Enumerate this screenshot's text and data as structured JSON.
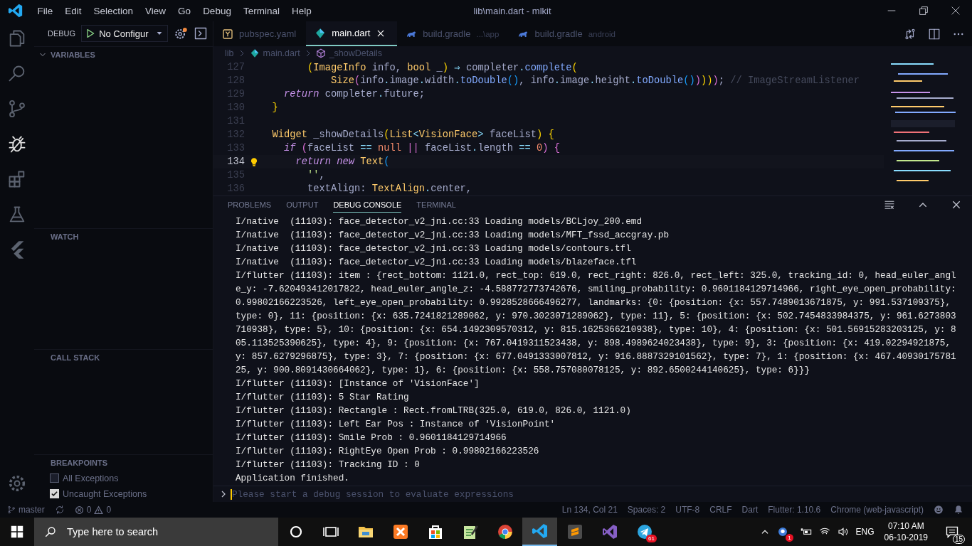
{
  "window": {
    "title": "lib\\main.dart - mlkit",
    "menu": [
      "File",
      "Edit",
      "Selection",
      "View",
      "Go",
      "Debug",
      "Terminal",
      "Help"
    ]
  },
  "activity_bar": {
    "items": [
      {
        "kind": "files",
        "selected": false
      },
      {
        "kind": "search",
        "selected": false
      },
      {
        "kind": "scm",
        "selected": false
      },
      {
        "kind": "debug",
        "selected": true
      },
      {
        "kind": "extensions",
        "selected": false
      },
      {
        "kind": "flask",
        "selected": false
      },
      {
        "kind": "flutter",
        "selected": false
      }
    ]
  },
  "sidebar": {
    "title": "DEBUG",
    "configuration": "No Configur",
    "sections": [
      {
        "title": "VARIABLES",
        "focused": true
      },
      {
        "title": "WATCH",
        "focused": false
      },
      {
        "title": "CALL STACK",
        "focused": false
      },
      {
        "title": "BREAKPOINTS",
        "focused": false,
        "items": [
          {
            "label": "All Exceptions",
            "checked": false
          },
          {
            "label": "Uncaught Exceptions",
            "checked": true
          }
        ]
      }
    ]
  },
  "tabs": [
    {
      "kind": "yaml",
      "label": "pubspec.yaml",
      "selected": false
    },
    {
      "kind": "dart",
      "label": "main.dart",
      "selected": true
    },
    {
      "kind": "gradle",
      "label": "build.gradle",
      "hint": "...\\app",
      "selected": false
    },
    {
      "kind": "gradle",
      "label": "build.gradle",
      "hint": "android",
      "selected": false
    }
  ],
  "breadcrumbs": [
    "lib",
    "main.dart",
    "_showDetails"
  ],
  "code": [
    {
      "number": "127",
      "current": false,
      "tokens": [
        {
          "text": "        (",
          "kind": "b1"
        },
        {
          "text": "ImageInfo",
          "kind": "t"
        },
        {
          "text": " info, ",
          "kind": "p"
        },
        {
          "text": "bool",
          "kind": "t"
        },
        {
          "text": " _",
          "kind": "p"
        },
        {
          "text": ")",
          "kind": "b1"
        },
        {
          "text": " ⇒ ",
          "kind": "o"
        },
        {
          "text": "completer",
          "kind": "p"
        },
        {
          "text": ".",
          "kind": "o"
        },
        {
          "text": "complete",
          "kind": "f"
        },
        {
          "text": "(",
          "kind": "b1"
        }
      ]
    },
    {
      "number": "128",
      "current": false,
      "tokens": [
        {
          "text": "            Size",
          "kind": "t"
        },
        {
          "text": "(",
          "kind": "b2"
        },
        {
          "text": "info",
          "kind": "p"
        },
        {
          "text": ".",
          "kind": "o"
        },
        {
          "text": "image",
          "kind": "p"
        },
        {
          "text": ".",
          "kind": "o"
        },
        {
          "text": "width",
          "kind": "p"
        },
        {
          "text": ".",
          "kind": "o"
        },
        {
          "text": "toDouble",
          "kind": "f"
        },
        {
          "text": "()",
          "kind": "b3"
        },
        {
          "text": ", info",
          "kind": "p"
        },
        {
          "text": ".",
          "kind": "o"
        },
        {
          "text": "image",
          "kind": "p"
        },
        {
          "text": ".",
          "kind": "o"
        },
        {
          "text": "height",
          "kind": "p"
        },
        {
          "text": ".",
          "kind": "o"
        },
        {
          "text": "toDouble",
          "kind": "f"
        },
        {
          "text": "()",
          "kind": "b3"
        },
        {
          "text": ")",
          "kind": "b2"
        },
        {
          "text": "))",
          "kind": "b1"
        },
        {
          "text": ")",
          "kind": "b2"
        },
        {
          "text": ";",
          "kind": "p"
        },
        {
          "text": " // ImageStreamListener",
          "kind": "c"
        }
      ]
    },
    {
      "number": "129",
      "current": false,
      "tokens": [
        {
          "text": "    return",
          "kind": "k"
        },
        {
          "text": " completer",
          "kind": "p"
        },
        {
          "text": ".",
          "kind": "o"
        },
        {
          "text": "future;",
          "kind": "p"
        }
      ]
    },
    {
      "number": "130",
      "current": false,
      "tokens": [
        {
          "text": "  }",
          "kind": "b1"
        }
      ]
    },
    {
      "number": "131",
      "current": false
    },
    {
      "number": "132",
      "current": false,
      "tokens": [
        {
          "text": "  Widget",
          "kind": "t"
        },
        {
          "text": " _showDetails",
          "kind": "p"
        },
        {
          "text": "(",
          "kind": "b1"
        },
        {
          "text": "List",
          "kind": "t"
        },
        {
          "text": "<",
          "kind": "o"
        },
        {
          "text": "VisionFace",
          "kind": "t"
        },
        {
          "text": ">",
          "kind": "o"
        },
        {
          "text": " faceList",
          "kind": "p"
        },
        {
          "text": ") {",
          "kind": "b1"
        }
      ]
    },
    {
      "number": "133",
      "current": false,
      "tokens": [
        {
          "text": "    if",
          "kind": "k"
        },
        {
          "text": " (",
          "kind": "b2"
        },
        {
          "text": "faceList ",
          "kind": "p"
        },
        {
          "text": "==",
          "kind": "o"
        },
        {
          "text": " null",
          "kind": "n"
        },
        {
          "text": " ||",
          "kind": "b2"
        },
        {
          "text": " faceList",
          "kind": "p"
        },
        {
          "text": ".",
          "kind": "o"
        },
        {
          "text": "length ",
          "kind": "p"
        },
        {
          "text": "==",
          "kind": "o"
        },
        {
          "text": " 0",
          "kind": "n"
        },
        {
          "text": ") {",
          "kind": "b2"
        }
      ]
    },
    {
      "number": "134",
      "current": true,
      "tokens": [
        {
          "text": "      return new",
          "kind": "k"
        },
        {
          "text": " Text",
          "kind": "t"
        },
        {
          "text": "(",
          "kind": "b3"
        }
      ]
    },
    {
      "number": "135",
      "current": false,
      "tokens": [
        {
          "text": "        ''",
          "kind": "s"
        },
        {
          "text": ",",
          "kind": "p"
        }
      ]
    },
    {
      "number": "136",
      "current": false,
      "tokens": [
        {
          "text": "        textAlign: ",
          "kind": "p"
        },
        {
          "text": "TextAlign",
          "kind": "t"
        },
        {
          "text": ".",
          "kind": "o"
        },
        {
          "text": "center,",
          "kind": "p"
        }
      ]
    }
  ],
  "panel": {
    "tabs": [
      {
        "label": "PROBLEMS",
        "selected": false
      },
      {
        "label": "OUTPUT",
        "selected": false
      },
      {
        "label": "DEBUG CONSOLE",
        "selected": true
      },
      {
        "label": "TERMINAL",
        "selected": false
      }
    ],
    "console": [
      "I/native  (11103): face_detector_v2_jni.cc:33 Loading models/BCLjoy_200.emd",
      "I/native  (11103): face_detector_v2_jni.cc:33 Loading models/MFT_fssd_accgray.pb",
      "I/native  (11103): face_detector_v2_jni.cc:33 Loading models/contours.tfl",
      "I/native  (11103): face_detector_v2_jni.cc:33 Loading models/blazeface.tfl",
      "I/flutter (11103): item : {rect_bottom: 1121.0, rect_top: 619.0, rect_right: 826.0, rect_left: 325.0, tracking_id: 0, head_euler_angle_y: -7.620493412017822, head_euler_angle_z: -4.588772773742676, smiling_probability: 0.9601184129714966, right_eye_open_probability: 0.99802166223526, left_eye_open_probability: 0.9928528666496277, landmarks: {0: {position: {x: 557.7489013671875, y: 991.537109375}, type: 0}, 11: {position: {x: 635.7241821289062, y: 970.3023071289062}, type: 11}, 5: {position: {x: 502.7454833984375, y: 961.6273803710938}, type: 5}, 10: {position: {x: 654.1492309570312, y: 815.1625366210938}, type: 10}, 4: {position: {x: 501.56915283203125, y: 805.113525390625}, type: 4}, 9: {position: {x: 767.0419311523438, y: 898.4989624023438}, type: 9}, 3: {position: {x: 419.02294921875, y: 857.6279296875}, type: 3}, 7: {position: {x: 677.0491333007812, y: 916.8887329101562}, type: 7}, 1: {position: {x: 467.4093017578125, y: 900.8091430664062}, type: 1}, 6: {position: {x: 558.757080078125, y: 892.6500244140625}, type: 6}}}",
      "I/flutter (11103): [Instance of 'VisionFace']",
      "I/flutter (11103): 5 Star Rating",
      "I/flutter (11103): Rectangle : Rect.fromLTRB(325.0, 619.0, 826.0, 1121.0)",
      "I/flutter (11103): Left Ear Pos : Instance of 'VisionPoint'",
      "I/flutter (11103): Smile Prob : 0.9601184129714966",
      "I/flutter (11103): RightEye Open Prob : 0.99802166223526",
      "I/flutter (11103): Tracking ID : 0",
      "Application finished."
    ],
    "input_placeholder": "Please start a debug session to evaluate expressions"
  },
  "status_bar": {
    "branch": "master",
    "errors": "0",
    "warnings": "0",
    "items": [
      "Ln 134, Col 21",
      "Spaces: 2",
      "UTF-8",
      "CRLF",
      "Dart",
      "Flutter: 1.10.6",
      "Chrome (web-javascript)"
    ]
  },
  "taskbar": {
    "search_placeholder": "Type here to search",
    "apps": [
      {
        "kind": "cortana",
        "selected": false
      },
      {
        "kind": "taskview",
        "selected": false
      },
      {
        "kind": "explorer",
        "selected": false
      },
      {
        "kind": "xampp",
        "selected": false
      },
      {
        "kind": "store",
        "selected": false
      },
      {
        "kind": "notepad",
        "selected": false
      },
      {
        "kind": "chrome",
        "selected": false
      },
      {
        "kind": "vscode",
        "selected": true
      },
      {
        "kind": "sublime",
        "selected": false
      },
      {
        "kind": "visualstudio",
        "selected": false
      },
      {
        "kind": "telegram",
        "selected": false,
        "badge": "61"
      }
    ],
    "tray_badge": "1",
    "language": "ENG",
    "time": "07:10 AM",
    "date": "06-10-2019",
    "notifications": "15"
  }
}
